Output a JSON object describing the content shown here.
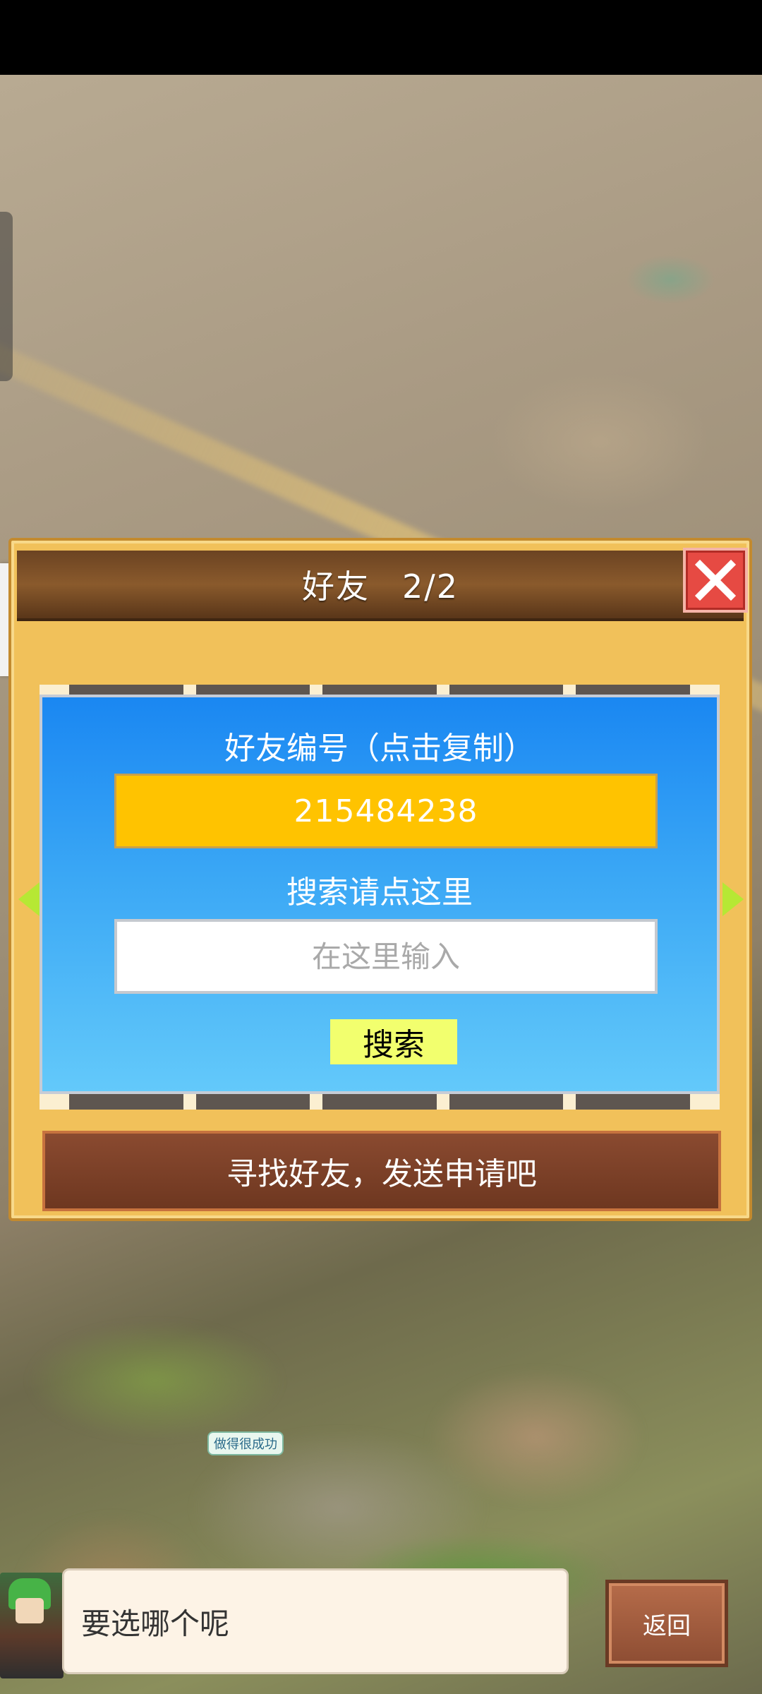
{
  "dialog": {
    "title": "好友",
    "page_count": "2/2",
    "close_icon": "close-x-icon"
  },
  "friend_card": {
    "id_label": "好友编号（点击复制）",
    "friend_id": "215484238",
    "search_label": "搜索请点这里",
    "search_placeholder": "在这里输入",
    "search_button": "搜索"
  },
  "banner_text": "寻找好友，发送申请吧",
  "map_bubble": "做得很成功",
  "bottom": {
    "dialogue_text": "要选哪个呢",
    "back_button": "返回"
  },
  "colors": {
    "accent_yellow": "#ffc300",
    "card_blue": "#1a87f2",
    "close_red": "#e64a43"
  }
}
